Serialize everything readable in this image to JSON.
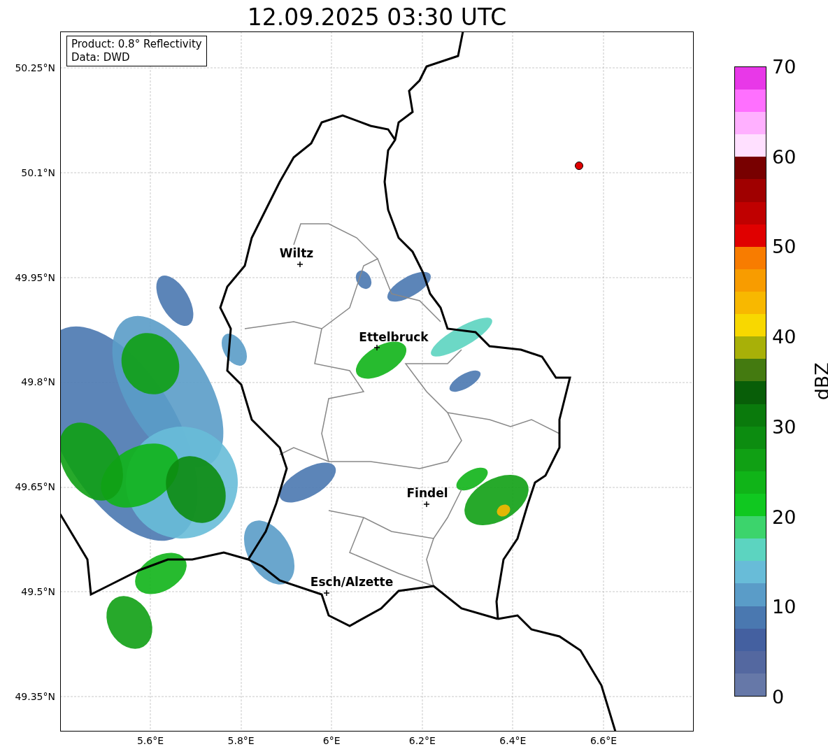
{
  "title": "12.09.2025 03:30 UTC",
  "info_box": [
    "Product: 0.8° Reflectivity",
    "Data: DWD"
  ],
  "x_ticks": [
    "5.6°E",
    "5.8°E",
    "6°E",
    "6.2°E",
    "6.4°E",
    "6.6°E"
  ],
  "y_ticks": [
    "50.25°N",
    "50.1°N",
    "49.95°N",
    "49.8°N",
    "49.65°N",
    "49.5°N",
    "49.35°N"
  ],
  "cities": [
    {
      "name": "Wiltz"
    },
    {
      "name": "Ettelbruck"
    },
    {
      "name": "Findel"
    },
    {
      "name": "Esch/Alzette"
    }
  ],
  "colorbar": {
    "label": "dBZ",
    "ticks": [
      "70",
      "60",
      "50",
      "40",
      "30",
      "20",
      "10",
      "0"
    ],
    "segments": [
      {
        "color": "#6678a8"
      },
      {
        "color": "#5468a0"
      },
      {
        "color": "#4460a0"
      },
      {
        "color": "#4a78b0"
      },
      {
        "color": "#5a9cc8"
      },
      {
        "color": "#68bcd8"
      },
      {
        "color": "#5cd4c0"
      },
      {
        "color": "#3cd46c"
      },
      {
        "color": "#10c820"
      },
      {
        "color": "#10b418"
      },
      {
        "color": "#10a014"
      },
      {
        "color": "#0c8c10"
      },
      {
        "color": "#0a7a0c"
      },
      {
        "color": "#085e08"
      },
      {
        "color": "#447a10"
      },
      {
        "color": "#a8b008"
      },
      {
        "color": "#f8d800"
      },
      {
        "color": "#f8b800"
      },
      {
        "color": "#f89c00"
      },
      {
        "color": "#f87c00"
      },
      {
        "color": "#e00000"
      },
      {
        "color": "#c00000"
      },
      {
        "color": "#a00000"
      },
      {
        "color": "#780000"
      },
      {
        "color": "#ffe0ff"
      },
      {
        "color": "#ffb0ff"
      },
      {
        "color": "#ff70ff"
      },
      {
        "color": "#e838e8"
      }
    ]
  }
}
